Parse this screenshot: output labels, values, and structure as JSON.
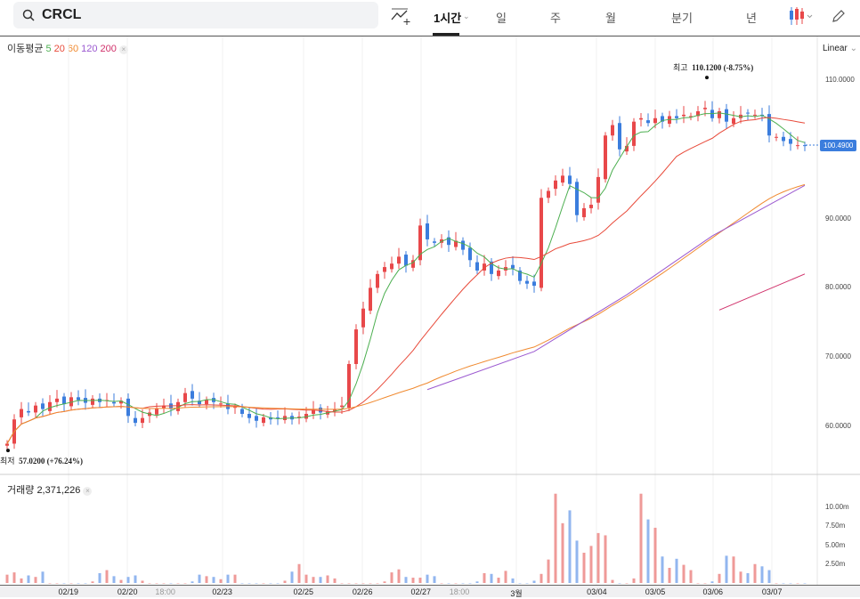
{
  "search": {
    "value": "CRCL",
    "icon": "search-icon"
  },
  "toolbar": {
    "interval": "1시간",
    "tabs": [
      "일",
      "주",
      "월",
      "분기",
      "년"
    ]
  },
  "legend": {
    "title": "이동평균",
    "periods": [
      "5",
      "20",
      "60",
      "120",
      "200"
    ],
    "colors": [
      "#4caf50",
      "#e84a3a",
      "#f08a30",
      "#9b59d0",
      "#d0306a"
    ]
  },
  "scale": {
    "mode": "Linear",
    "ticks": [
      "110.0000",
      "100.0000",
      "90.0000",
      "80.0000",
      "70.0000",
      "60.0000"
    ],
    "current": "100.4900"
  },
  "annotations": {
    "high": "최고",
    "high_value": "110.1200 (-8.75%)",
    "low": "최저",
    "low_value": "57.0200 (+76.24%)"
  },
  "volume": {
    "label": "거래량",
    "value": "2,371,226",
    "ticks": [
      "10.00m",
      "7.50m",
      "5.00m",
      "2.50m"
    ]
  },
  "xaxis": [
    {
      "t": "02/19",
      "i": 8.6
    },
    {
      "t": "02/20",
      "i": 16.9
    },
    {
      "t": "18:00",
      "i": 22.2,
      "g": 1
    },
    {
      "t": "02/23",
      "i": 30.2
    },
    {
      "t": "02/25",
      "i": 41.6
    },
    {
      "t": "02/26",
      "i": 49.9
    },
    {
      "t": "02/27",
      "i": 58.1
    },
    {
      "t": "18:00",
      "i": 63.5,
      "g": 1
    },
    {
      "t": "3월",
      "i": 71.5
    },
    {
      "t": "03/04",
      "i": 82.8
    },
    {
      "t": "03/05",
      "i": 91
    },
    {
      "t": "03/06",
      "i": 99.1
    },
    {
      "t": "03/07",
      "i": 107.4
    }
  ],
  "chart_data": {
    "type": "candlestick",
    "up_color": "#e8484a",
    "down_color": "#3b7ddd",
    "ylim": [
      55,
      115
    ],
    "closes": [
      57.5,
      61,
      62.5,
      62,
      63,
      62.5,
      63.5,
      64,
      63.2,
      64.2,
      63.8,
      63.4,
      64,
      63.5,
      63.8,
      63.3,
      63.7,
      61.5,
      60.5,
      61.2,
      62,
      62.6,
      63,
      62.5,
      63.5,
      64.8,
      64,
      63.2,
      63.8,
      63.5,
      63.3,
      62.5,
      62.8,
      61.8,
      61.2,
      60.8,
      61.3,
      61,
      61.2,
      61.5,
      61,
      61.4,
      61.8,
      62.4,
      62,
      62.2,
      62.5,
      63,
      69,
      74,
      77,
      80,
      82,
      83,
      83.5,
      84.5,
      83.2,
      84,
      89,
      87,
      86.5,
      87,
      86.2,
      86.8,
      85.5,
      84,
      82.5,
      83.5,
      82,
      82.5,
      83,
      82.8,
      81,
      80.6,
      80.3,
      93,
      94,
      95.5,
      96.2,
      95,
      90.5,
      91.5,
      92,
      96,
      102,
      103.5,
      100,
      100.5,
      104,
      104.5,
      103.8,
      104.5,
      104,
      104.8,
      104.5,
      105,
      104.8,
      105.5,
      106,
      104.5,
      105.5,
      104,
      104.5,
      105,
      105.2,
      105,
      104.8,
      102,
      101.8,
      101.2,
      100.8,
      100.6,
      100.49
    ],
    "volumes_m": [
      1.1,
      1.4,
      0.6,
      1,
      0.8,
      1.5,
      0,
      0,
      0,
      0,
      0,
      0,
      0.2,
      1.3,
      1.7,
      0.9,
      0.4,
      0.8,
      1,
      0.3,
      0,
      0,
      0,
      0,
      0,
      0,
      0.2,
      1.1,
      0.9,
      0.8,
      0.5,
      1.1,
      1.1,
      0,
      0,
      0,
      0,
      0,
      0,
      0.3,
      1.5,
      2.5,
      1.1,
      0.8,
      0.8,
      1,
      0.6,
      0,
      0,
      0,
      0,
      0,
      0,
      0.2,
      1.4,
      1.8,
      0.8,
      0.7,
      0.7,
      1.1,
      0.9,
      0,
      0,
      0,
      0,
      0,
      0.2,
      1.3,
      1.2,
      0.7,
      1.6,
      0.6,
      0,
      0,
      0.3,
      1.2,
      3.1,
      11.8,
      7.9,
      9.6,
      5.6,
      4,
      4.9,
      6.6,
      6.3,
      0.4,
      0,
      0,
      0.6,
      11.8,
      8.4,
      7.3,
      3.5,
      2,
      3.2,
      2.4,
      1.7,
      0,
      0,
      0.2,
      1.2,
      3.6,
      3.5,
      1.5,
      1.3,
      2.5,
      2.2,
      1.7,
      0,
      0,
      0,
      0
    ],
    "ma120_points": [
      [
        59,
        65.3
      ],
      [
        74,
        70.8
      ],
      [
        87,
        79
      ],
      [
        99,
        87.5
      ],
      [
        112,
        94.8
      ]
    ],
    "ma200_points": [
      [
        100,
        76.8
      ],
      [
        112,
        82
      ]
    ],
    "high": {
      "index": 98,
      "value": 110.12
    },
    "low": {
      "index": 0,
      "value": 57.02
    }
  }
}
